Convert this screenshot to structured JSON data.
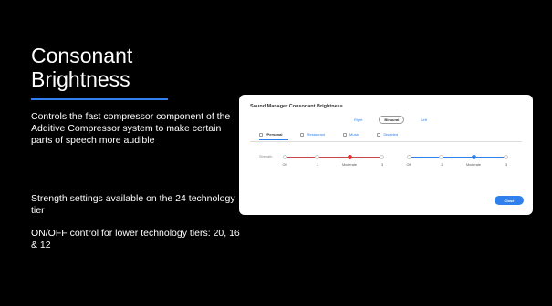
{
  "slide": {
    "title": "Consonant Brightness",
    "description": "Controls the fast compressor component of the Additive Compressor system to make certain parts of speech more audible",
    "bullet1": "Strength settings available on the 24 technology tier",
    "bullet2": "ON/OFF control for lower technology tiers: 20, 16 & 12"
  },
  "panel": {
    "title": "Sound Manager Consonant Brightness",
    "ear_options": [
      "Right",
      "Binaural",
      "Left"
    ],
    "ear_selected": "Binaural",
    "tabs": [
      "*Personal",
      "Restaurant",
      "Music",
      "Disabled"
    ],
    "active_tab": "*Personal",
    "strength_label": "Strength",
    "left_ticks": [
      "Off",
      "1",
      "Moderate",
      "3"
    ],
    "right_ticks": [
      "Off",
      "1",
      "Moderate",
      "3"
    ],
    "left_selected": "Moderate",
    "right_selected": "Moderate",
    "close_label": "Close"
  },
  "colors": {
    "accent": "#2f80ed",
    "left_ear": "#d33333",
    "background": "#000000"
  }
}
